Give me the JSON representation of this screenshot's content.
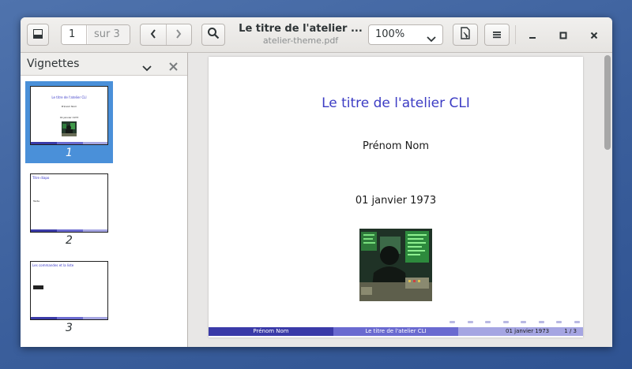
{
  "header": {
    "page_number": "1",
    "page_of": "sur 3",
    "title": "Le titre de l'atelier ...",
    "subtitle": "atelier-theme.pdf",
    "zoom": "100%"
  },
  "icons": {
    "sidebar_toggle": "sidebar-toggle-icon",
    "prev": "chevron-left-icon",
    "next": "chevron-right-icon",
    "search": "search-icon",
    "annotations": "document-annotate-icon",
    "menu": "hamburger-menu-icon",
    "minimize": "minimize-icon",
    "maximize": "maximize-icon",
    "close": "close-icon"
  },
  "sidebar": {
    "label": "Vignettes",
    "thumbnails": [
      {
        "num": "1",
        "title": "Le titre de l'atelier CLI",
        "author": "Prénom Nom",
        "date": "01 janvier 1973"
      },
      {
        "num": "2",
        "title": "Titre diapo",
        "body": "Texte"
      },
      {
        "num": "3",
        "title": "Les commandes et la liste"
      }
    ]
  },
  "page": {
    "title": "Le titre de l'atelier CLI",
    "author": "Prénom Nom",
    "date": "01 janvier 1973",
    "footer": {
      "author": "Prénom Nom",
      "title": "Le titre de l'atelier CLI",
      "date": "01 janvier 1973",
      "pagenum": "1 / 3"
    }
  },
  "colors": {
    "accent": "#4a90d9",
    "beamer_title": "#3c3cc4",
    "footer_dark": "#3a3aa8",
    "footer_mid": "#6a6ad0",
    "footer_light": "#a5a5e2"
  }
}
